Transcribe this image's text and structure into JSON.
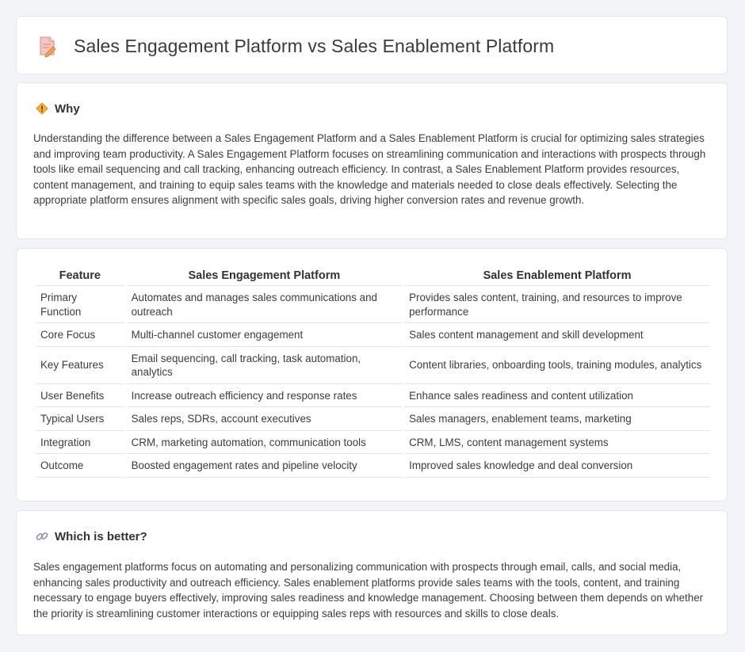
{
  "header": {
    "title": "Sales Engagement Platform vs Sales Enablement Platform",
    "icon": "document-pencil-icon"
  },
  "why": {
    "heading": "Why",
    "icon": "diamond-sign-icon",
    "text": "Understanding the difference between a Sales Engagement Platform and a Sales Enablement Platform is crucial for optimizing sales strategies and improving team productivity. A Sales Engagement Platform focuses on streamlining communication and interactions with prospects through tools like email sequencing and call tracking, enhancing outreach efficiency. In contrast, a Sales Enablement Platform provides resources, content management, and training to equip sales teams with the knowledge and materials needed to close deals effectively. Selecting the appropriate platform ensures alignment with specific sales goals, driving higher conversion rates and revenue growth."
  },
  "table": {
    "columns": [
      "Feature",
      "Sales Engagement Platform",
      "Sales Enablement Platform"
    ],
    "rows": [
      [
        "Primary Function",
        "Automates and manages sales communications and outreach",
        "Provides sales content, training, and resources to improve performance"
      ],
      [
        "Core Focus",
        "Multi-channel customer engagement",
        "Sales content management and skill development"
      ],
      [
        "Key Features",
        "Email sequencing, call tracking, task automation, analytics",
        "Content libraries, onboarding tools, training modules, analytics"
      ],
      [
        "User Benefits",
        "Increase outreach efficiency and response rates",
        "Enhance sales readiness and content utilization"
      ],
      [
        "Typical Users",
        "Sales reps, SDRs, account executives",
        "Sales managers, enablement teams, marketing"
      ],
      [
        "Integration",
        "CRM, marketing automation, communication tools",
        "CRM, LMS, content management systems"
      ],
      [
        "Outcome",
        "Boosted engagement rates and pipeline velocity",
        "Improved sales knowledge and deal conversion"
      ]
    ]
  },
  "better": {
    "heading": "Which is better?",
    "icon": "link-icon",
    "text": "Sales engagement platforms focus on automating and personalizing communication with prospects through email, calls, and social media, enhancing sales productivity and outreach efficiency. Sales enablement platforms provide sales teams with the tools, content, and training necessary to engage buyers effectively, improving sales readiness and knowledge management. Choosing between them depends on whether the priority is streamlining customer interactions or equipping sales reps with resources and skills to close deals."
  },
  "colors": {
    "background": "#f3f4f7",
    "card": "#ffffff",
    "border": "#e3e5ea",
    "icon_accent": "#e8734a"
  }
}
